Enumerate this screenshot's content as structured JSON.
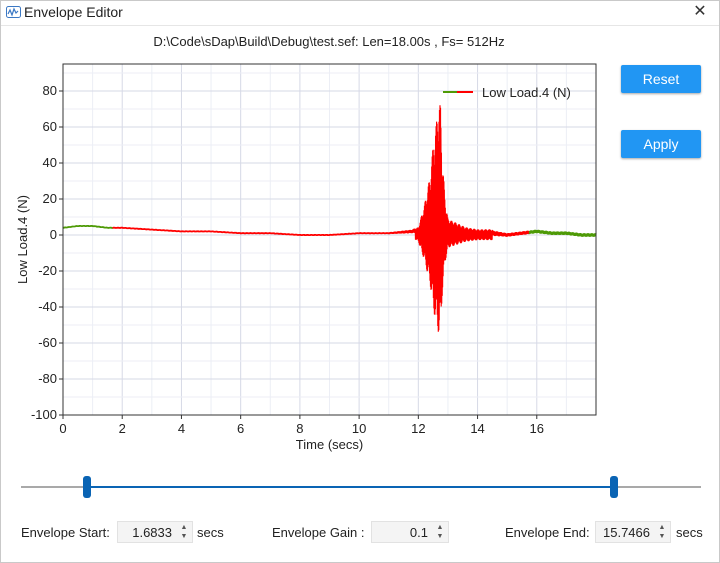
{
  "window": {
    "title": "Envelope Editor",
    "close_glyph": "✕"
  },
  "file_info": "D:\\Code\\sDap\\Build\\Debug\\test.sef: Len=18.00s , Fs= 512Hz",
  "buttons": {
    "reset": "Reset",
    "apply": "Apply"
  },
  "icons": {
    "app": "app-envelope-icon",
    "close": "close-icon"
  },
  "colors": {
    "accent": "#2196f3",
    "signal_in_envelope": "#ff0000",
    "signal_out_envelope": "#4e9a06",
    "slider_track": "#0a64b4"
  },
  "chart_data": {
    "type": "line",
    "xlabel": "Time (secs)",
    "ylabel": "Low Load.4 (N)",
    "xlim": [
      0,
      18
    ],
    "ylim": [
      -100,
      95
    ],
    "xticks": [
      0,
      2,
      4,
      6,
      8,
      10,
      12,
      14,
      16
    ],
    "yticks": [
      -100,
      -80,
      -60,
      -40,
      -20,
      0,
      20,
      40,
      60,
      80
    ],
    "grid": true,
    "legend": {
      "placement": "top-right",
      "entries": [
        "Low Load.4 (N)"
      ]
    },
    "envelope_start": 1.6833,
    "envelope_end": 15.7466,
    "series": [
      {
        "name": "Low Load.4 (N)",
        "x": [
          0,
          0.5,
          1.0,
          1.5,
          2.0,
          3.0,
          4.0,
          5.0,
          6.0,
          7.0,
          8.0,
          9.0,
          10.0,
          11.0,
          11.8,
          12.0,
          12.2,
          12.4,
          12.5,
          12.6,
          12.65,
          12.7,
          12.75,
          12.8,
          12.9,
          13.0,
          13.3,
          13.6,
          14.0,
          14.5,
          15.0,
          15.5,
          16.0,
          16.5,
          17.0,
          17.5,
          18.0
        ],
        "values": [
          4,
          5,
          5,
          4,
          4,
          3,
          2,
          2,
          1,
          1,
          0,
          0,
          1,
          1,
          2,
          3,
          8,
          18,
          30,
          40,
          55,
          60,
          62,
          35,
          15,
          6,
          4,
          2,
          1,
          1,
          0,
          1,
          2,
          1,
          1,
          0,
          0
        ],
        "oscillation_amplitude": [
          1,
          1,
          1,
          1,
          1,
          1,
          1,
          1,
          1,
          1,
          1,
          1,
          1,
          1,
          2,
          4,
          15,
          30,
          45,
          55,
          60,
          65,
          62,
          40,
          18,
          8,
          6,
          4,
          3,
          3,
          2,
          2,
          2,
          2,
          2,
          2,
          2
        ]
      }
    ]
  },
  "slider": {
    "min": 0,
    "max": 18,
    "low": 1.6833,
    "high": 15.7466
  },
  "envelope_start": {
    "label": "Envelope Start:",
    "value": "1.6833",
    "unit": "secs"
  },
  "envelope_gain": {
    "label": "Envelope Gain :",
    "value": "0.1"
  },
  "envelope_end": {
    "label": "Envelope End:",
    "value": "15.7466",
    "unit": "secs"
  }
}
